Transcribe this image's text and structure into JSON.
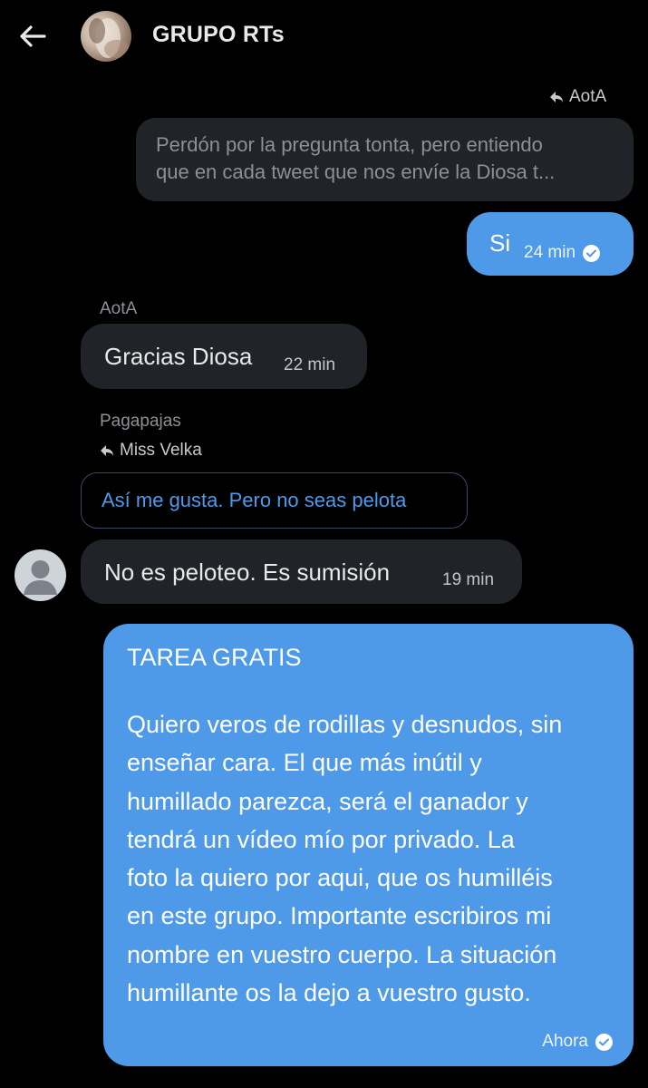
{
  "header": {
    "title": "GRUPO RTs"
  },
  "messages": {
    "reply_to_aota": "AotA",
    "quoted_outgoing": {
      "line1": "Perdón por la pregunta tonta, pero entiendo",
      "line2": "que en cada tweet que nos envíe la Diosa t..."
    },
    "si": {
      "text": "Si",
      "time": "24 min"
    },
    "gracias": {
      "sender": "AotA",
      "text": "Gracias Diosa",
      "time": "22 min"
    },
    "peloteo": {
      "sender": "Pagapajas",
      "reply_to": "Miss Velka",
      "quoted": "Así me gusta. Pero no seas pelota",
      "text": "No es peloteo. Es sumisión",
      "time": "19 min"
    },
    "tarea": {
      "title": "TAREA GRATIS",
      "lines": [
        "Quiero veros de rodillas y desnudos, sin",
        "enseñar cara. El que más inútil y",
        "humillado parezca, será el ganador y",
        "tendrá un vídeo mío por privado. La",
        "foto la quiero por aqui, que os humilléis",
        "en este grupo. Importante escribiros mi",
        "nombre en vuestro cuerpo. La situación",
        "humillante os la dejo a vuestro gusto."
      ],
      "time": "Ahora"
    }
  },
  "colors": {
    "background": "#000000",
    "outgoing_bubble": "#4f9ae8",
    "incoming_bubble": "#202327",
    "muted_text": "#8b9196",
    "link_blue": "#4f9ae8"
  },
  "icons": [
    "back-arrow-icon",
    "reply-icon",
    "check-circle-icon",
    "default-avatar-icon"
  ]
}
